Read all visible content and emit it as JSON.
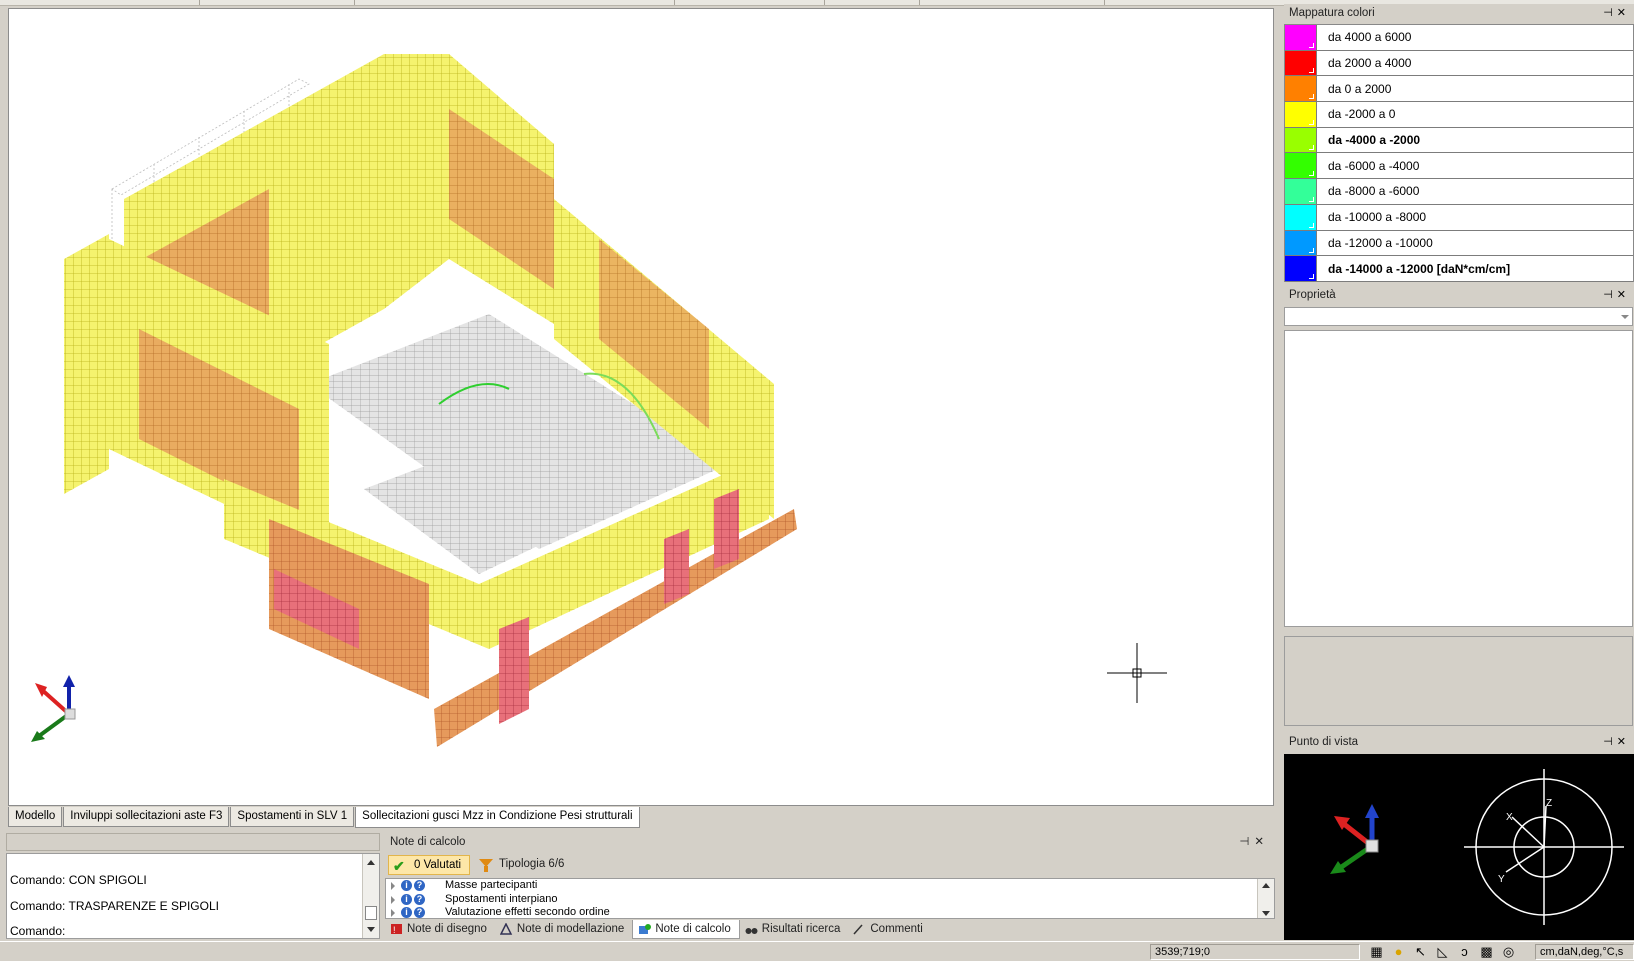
{
  "legend": {
    "title": "Mappatura colori",
    "rows": [
      {
        "label": "da 4000 a 6000",
        "color": "#ff00ff",
        "bold": false
      },
      {
        "label": "da 2000 a 4000",
        "color": "#ff0000",
        "bold": false
      },
      {
        "label": "da 0 a 2000",
        "color": "#ff8000",
        "bold": false
      },
      {
        "label": "da -2000 a 0",
        "color": "#ffff00",
        "bold": false
      },
      {
        "label": "da -4000 a -2000",
        "color": "#99ff00",
        "bold": true
      },
      {
        "label": "da -6000 a -4000",
        "color": "#33ff00",
        "bold": false
      },
      {
        "label": "da -8000 a -6000",
        "color": "#33ff99",
        "bold": false
      },
      {
        "label": "da -10000 a -8000",
        "color": "#00ffff",
        "bold": false
      },
      {
        "label": "da -12000 a -10000",
        "color": "#0099ff",
        "bold": false
      },
      {
        "label": "da -14000 a -12000  [daN*cm/cm]",
        "color": "#0000ff",
        "bold": true
      }
    ]
  },
  "properties": {
    "title": "Proprietà"
  },
  "viewpoint": {
    "title": "Punto di vista",
    "axes": [
      "X",
      "Y",
      "Z"
    ]
  },
  "viewport_tabs": [
    {
      "label": "Modello",
      "active": false
    },
    {
      "label": "Inviluppi sollecitazioni aste F3",
      "active": false
    },
    {
      "label": "Spostamenti in SLV 1",
      "active": false
    },
    {
      "label": "Sollecitazioni gusci Mzz in Condizione Pesi strutturali",
      "active": true
    }
  ],
  "command": {
    "lines": [
      "Comando: CON SPIGOLI",
      "Comando: TRASPARENZE E SPIGOLI",
      "Comando:"
    ]
  },
  "notes": {
    "title": "Note di calcolo",
    "valutati": "0 Valutati",
    "tipologia": "Tipologia 6/6",
    "items": [
      "Masse partecipanti",
      "Spostamenti interpiano",
      "Valutazione effetti secondo ordine"
    ],
    "tabs": [
      "Note di disegno",
      "Note di modellazione",
      "Note di calcolo",
      "Risultati ricerca",
      "Commenti"
    ]
  },
  "status": {
    "coords": "3539;719;0",
    "units": "cm,daN,deg,°C,s"
  },
  "colors": {
    "mesh_yellow": "#f3f06a",
    "mesh_orange": "#e89a5a",
    "mesh_red": "#e86070",
    "mesh_gray": "#d8d8d8"
  }
}
